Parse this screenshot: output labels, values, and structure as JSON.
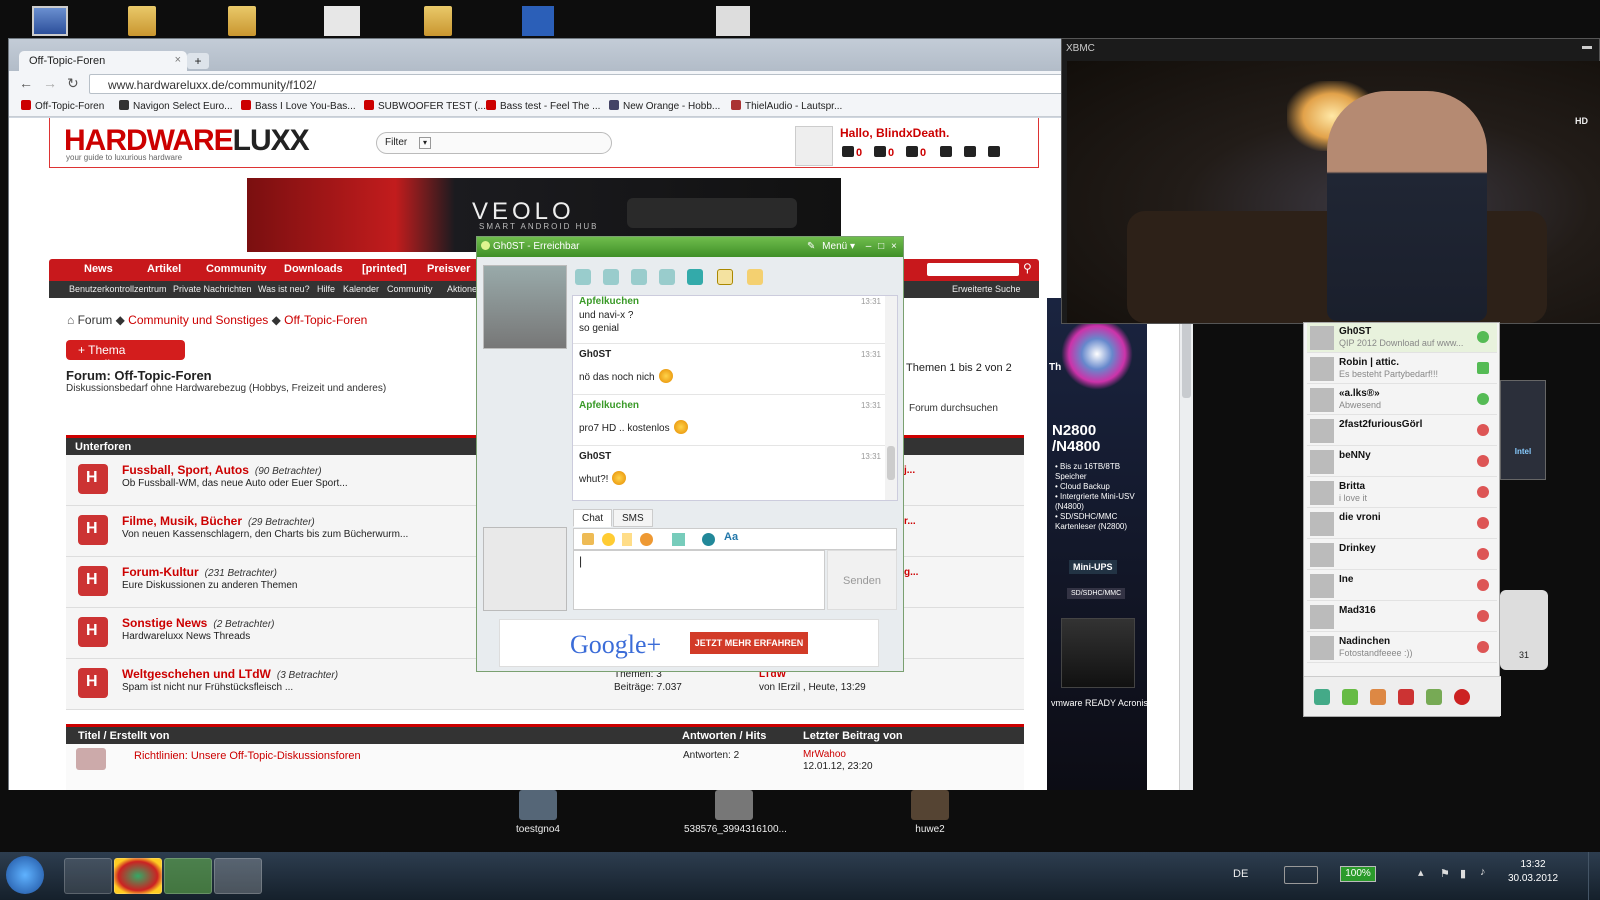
{
  "desktop": {
    "top_icons": [
      {
        "label": "",
        "icon": "computer-icon"
      },
      {
        "label": "",
        "icon": "folder-icon"
      },
      {
        "label": "",
        "icon": "folder-icon"
      },
      {
        "label": "",
        "icon": "document-icon"
      },
      {
        "label": "",
        "icon": "folder-icon"
      },
      {
        "label": "",
        "icon": "word-document-icon"
      },
      {
        "label": "",
        "icon": "image-icon"
      }
    ],
    "bottom_icons": [
      {
        "label": "toestgno4"
      },
      {
        "label": "538576_3994316100..."
      },
      {
        "label": "huwe2"
      }
    ]
  },
  "browser": {
    "tab_title": "Off-Topic-Foren",
    "new_tab": "+",
    "url": "www.hardwareluxx.de/community/f102/",
    "bookmarks": [
      "Off-Topic-Foren",
      "Navigon Select Euro...",
      "Bass I Love You-Bas...",
      "SUBWOOFER TEST (...",
      "Bass test - Feel The ...",
      "New Orange - Hobb...",
      "ThielAudio - Lautspr..."
    ]
  },
  "site": {
    "logo_a": "HARDWARE",
    "logo_b": "LUXX",
    "tagline": "your guide to luxurious hardware",
    "filter_label": "Filter",
    "greeting": "Hallo, BlindxDeath.",
    "counters": [
      "0",
      "0",
      "0"
    ],
    "banner_brand": "VEOLO",
    "banner_sub": "SMART ANDROID HUB",
    "nav": [
      "News",
      "Artikel",
      "Community",
      "Downloads",
      "[printed]",
      "Preisver"
    ],
    "subnav": [
      "Benutzerkontrollzentrum",
      "Private Nachrichten",
      "Was ist neu?",
      "Hilfe",
      "Kalender",
      "Community",
      "Aktione"
    ],
    "extended_search": "Erweiterte Suche",
    "breadcrumb": [
      "Forum",
      "Community und Sonstiges",
      "Off-Topic-Foren"
    ],
    "new_thread": "+ Thema erstellen",
    "forum_title": "Forum: Off-Topic-Foren",
    "forum_desc": "Diskussionsbedarf ohne Hardwarebezug (Hobbys, Freizeit und anderes)",
    "themen_count": "Themen 1 bis 2 von 2",
    "forum_search": "Forum durchsuchen",
    "subforums_header": "Unterforen",
    "subforums": [
      {
        "name": "Fussball, Sport, Autos",
        "viewers": "(90 Betrachter)",
        "desc": "Ob Fussball-WM, das neue Auto oder Euer Sport..."
      },
      {
        "name": "Filme, Musik, Bücher",
        "viewers": "(29 Betrachter)",
        "desc": "Von neuen Kassenschlagern, den Charts bis zum Bücherwurm..."
      },
      {
        "name": "Forum-Kultur",
        "viewers": "(231 Betrachter)",
        "desc": "Eure Diskussionen zu anderen Themen"
      },
      {
        "name": "Sonstige News",
        "viewers": "(2 Betrachter)",
        "desc": "Hardwareluxx News Threads"
      },
      {
        "name": "Weltgeschehen und LTdW",
        "viewers": "(3 Betrachter)",
        "desc": "Spam ist nicht nur Frühstücksfleisch ..."
      }
    ],
    "last_fragments": [
      "j...",
      "r...",
      "g..."
    ],
    "stats_themen": "Themen: 3",
    "stats_beitraege": "Beiträge: 7.037",
    "lastpost_title": "LTdW",
    "lastpost_by": "von IErzil , Heute, 13:29",
    "threads_header_title": "Titel / Erstellt von",
    "threads_header_replies": "Antworten / Hits",
    "threads_header_last": "Letzter Beitrag von",
    "thread_title": "Richtlinien: Unsere Off-Topic-Diskussionsforen",
    "thread_replies": "Antworten: 2",
    "thread_last_user": "MrWahoo",
    "thread_last_date": "12.01.12, 23:20"
  },
  "skyscraper": {
    "model": "N2800 /N4800",
    "features": [
      "• Bis zu 16TB/8TB Speicher",
      "• Cloud Backup",
      "• Intergrierte Mini-USV (N4800)",
      "• SD/SDHC/MMC Kartenleser (N2800)"
    ],
    "badge_ups": "Mini-UPS",
    "badge_sd": "SD/SDHC/MMC",
    "brands": "vmware READY   Acronis",
    "th": "Th"
  },
  "xbmc": {
    "title": "XBMC",
    "hd": "HD"
  },
  "chat": {
    "title": "Gh0ST - Erreichbar",
    "menu": "Menü",
    "messages": [
      {
        "who": "Apfelkuchen",
        "time": "13:31",
        "lines": [
          "und navi-x ?",
          "so genial"
        ],
        "smile": false,
        "color": "#3a9a28"
      },
      {
        "who": "Gh0ST",
        "time": "13:31",
        "lines": [
          "nö das noch nich"
        ],
        "smile": true,
        "color": "#222"
      },
      {
        "who": "Apfelkuchen",
        "time": "13:31",
        "lines": [
          "pro7 HD .. kostenlos"
        ],
        "smile": true,
        "color": "#3a9a28"
      },
      {
        "who": "Gh0ST",
        "time": "13:31",
        "lines": [
          "whut?!"
        ],
        "smile": true,
        "color": "#222"
      }
    ],
    "tab_chat": "Chat",
    "tab_sms": "SMS",
    "input_value": "|",
    "send": "Senden",
    "ad_logo": "Google+",
    "ad_button": "JETZT MEHR ERFAHREN"
  },
  "buddies": [
    {
      "name": "Gh0ST",
      "status": "QIP 2012 Download auf www..."
    },
    {
      "name": "Robin | attic.",
      "status": "Es besteht Partybedarf!!!"
    },
    {
      "name": "«a.lks®»",
      "status": "Abwesend"
    },
    {
      "name": "2fast2furiousGörl",
      "status": ""
    },
    {
      "name": "beNNy",
      "status": ""
    },
    {
      "name": "Britta",
      "status": "i love it"
    },
    {
      "name": "die vroni",
      "status": ""
    },
    {
      "name": "Drinkey",
      "status": ""
    },
    {
      "name": "Ine",
      "status": ""
    },
    {
      "name": "Mad316",
      "status": ""
    },
    {
      "name": "Nadinchen",
      "status": "Fotostandfeeee :))"
    }
  ],
  "widgets": {
    "cpu_text": "Intel",
    "calendar_day": "31"
  },
  "taskbar": {
    "lang": "DE",
    "battery": "100%",
    "time": "13:32",
    "date": "30.03.2012"
  }
}
